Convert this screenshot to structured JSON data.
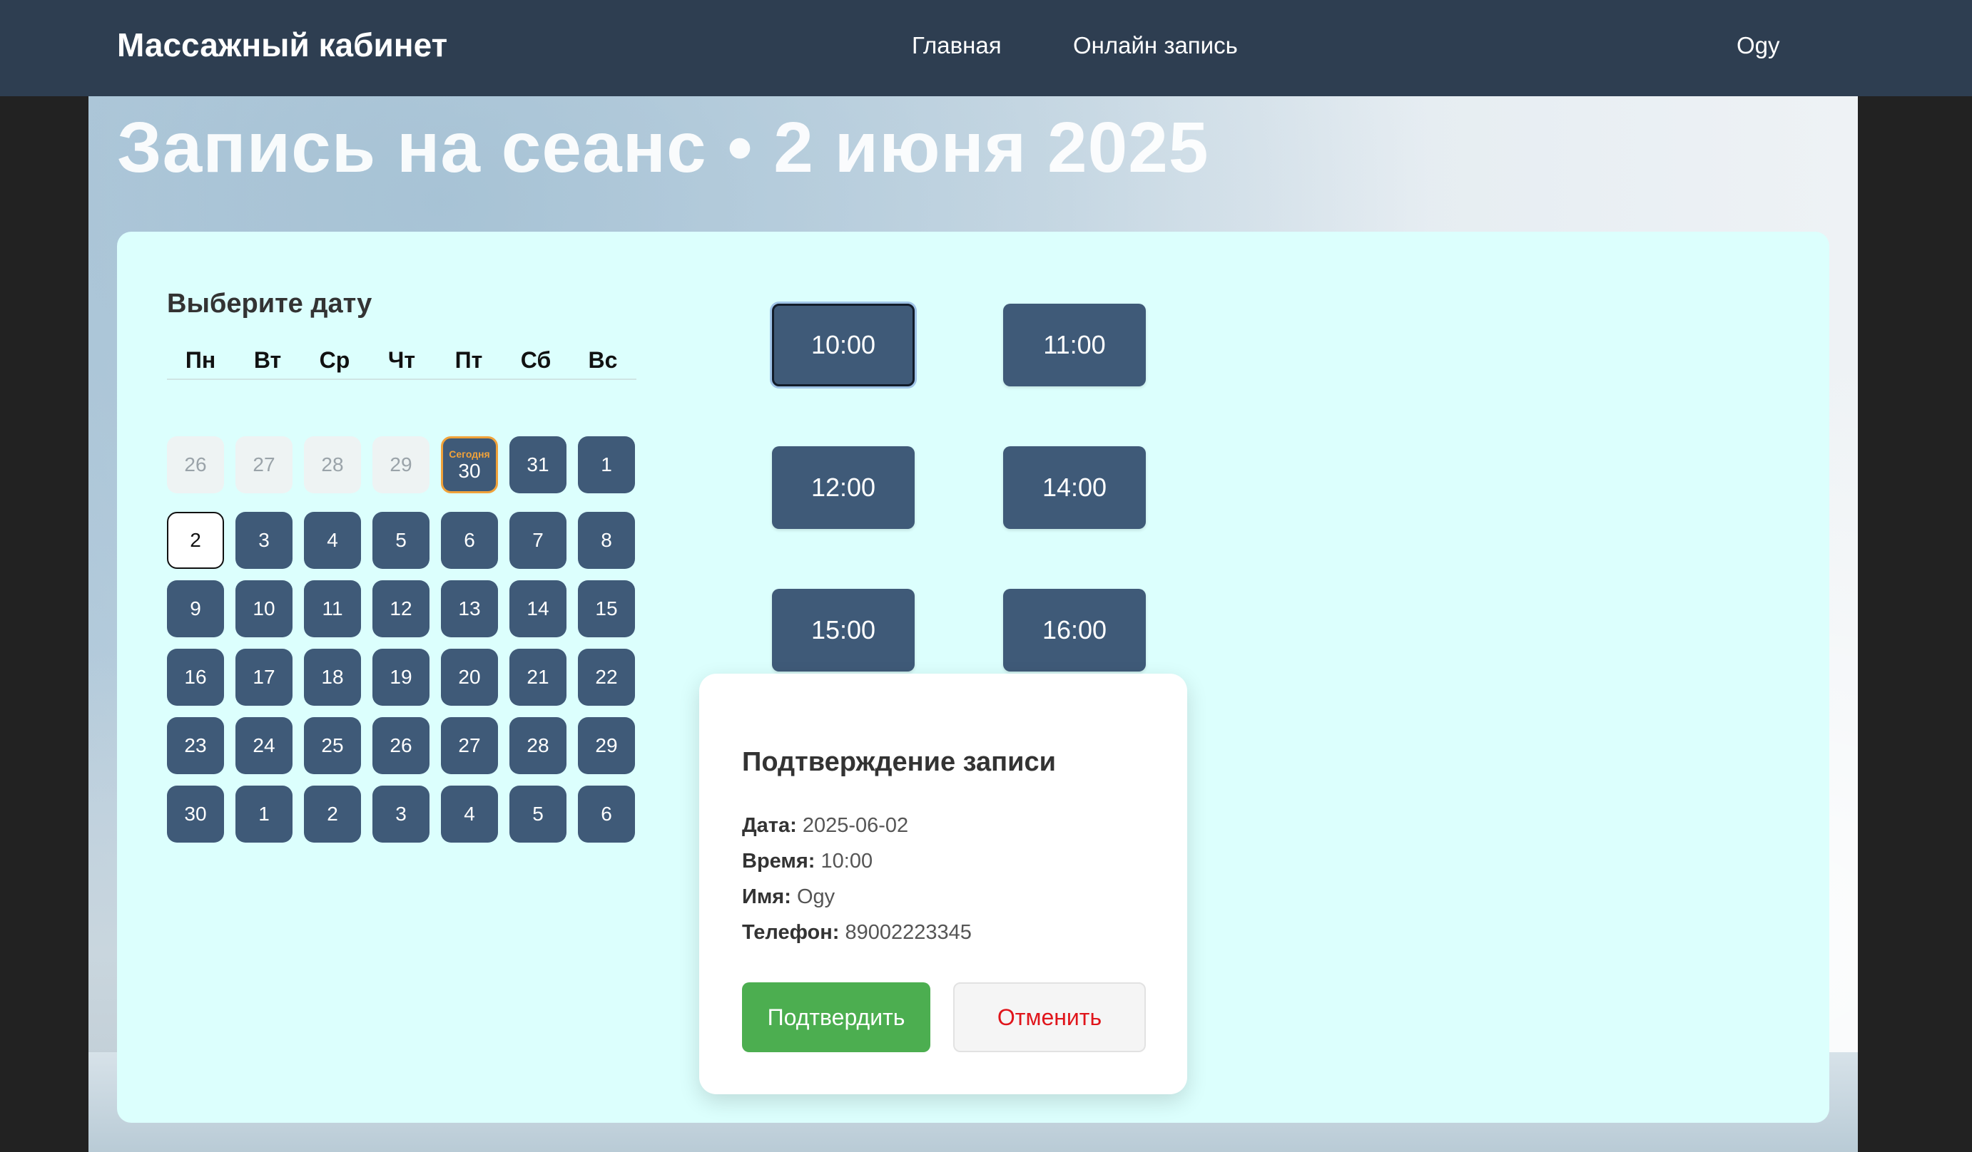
{
  "navbar": {
    "brand": "Массажный кабинет",
    "links": [
      "Главная",
      "Онлайн запись"
    ],
    "user": "Ogy"
  },
  "page": {
    "title": "Запись на сеанс • 2 июня 2025"
  },
  "calendar": {
    "title": "Выберите дату",
    "weekdays": [
      "Пн",
      "Вт",
      "Ср",
      "Чт",
      "Пт",
      "Сб",
      "Вс"
    ],
    "today_label": "Сегодня",
    "days": [
      {
        "n": "26",
        "state": "disabled"
      },
      {
        "n": "27",
        "state": "disabled"
      },
      {
        "n": "28",
        "state": "disabled"
      },
      {
        "n": "29",
        "state": "disabled"
      },
      {
        "n": "30",
        "state": "today"
      },
      {
        "n": "31",
        "state": "normal"
      },
      {
        "n": "1",
        "state": "normal"
      },
      {
        "n": "2",
        "state": "selected"
      },
      {
        "n": "3",
        "state": "normal"
      },
      {
        "n": "4",
        "state": "normal"
      },
      {
        "n": "5",
        "state": "normal"
      },
      {
        "n": "6",
        "state": "normal"
      },
      {
        "n": "7",
        "state": "normal"
      },
      {
        "n": "8",
        "state": "normal"
      },
      {
        "n": "9",
        "state": "normal"
      },
      {
        "n": "10",
        "state": "normal"
      },
      {
        "n": "11",
        "state": "normal"
      },
      {
        "n": "12",
        "state": "normal"
      },
      {
        "n": "13",
        "state": "normal"
      },
      {
        "n": "14",
        "state": "normal"
      },
      {
        "n": "15",
        "state": "normal"
      },
      {
        "n": "16",
        "state": "normal"
      },
      {
        "n": "17",
        "state": "normal"
      },
      {
        "n": "18",
        "state": "normal"
      },
      {
        "n": "19",
        "state": "normal"
      },
      {
        "n": "20",
        "state": "normal"
      },
      {
        "n": "21",
        "state": "normal"
      },
      {
        "n": "22",
        "state": "normal"
      },
      {
        "n": "23",
        "state": "normal"
      },
      {
        "n": "24",
        "state": "normal"
      },
      {
        "n": "25",
        "state": "normal"
      },
      {
        "n": "26",
        "state": "normal"
      },
      {
        "n": "27",
        "state": "normal"
      },
      {
        "n": "28",
        "state": "normal"
      },
      {
        "n": "29",
        "state": "normal"
      },
      {
        "n": "30",
        "state": "normal"
      },
      {
        "n": "1",
        "state": "normal"
      },
      {
        "n": "2",
        "state": "normal"
      },
      {
        "n": "3",
        "state": "normal"
      },
      {
        "n": "4",
        "state": "normal"
      },
      {
        "n": "5",
        "state": "normal"
      },
      {
        "n": "6",
        "state": "normal"
      }
    ]
  },
  "time_slots": {
    "selected": "10:00",
    "items": [
      "10:00",
      "11:00",
      "12:00",
      "14:00",
      "15:00",
      "16:00"
    ]
  },
  "modal": {
    "title": "Подтверждение записи",
    "rows": [
      {
        "label": "Дата:",
        "value": "2025-06-02"
      },
      {
        "label": "Время:",
        "value": "10:00"
      },
      {
        "label": "Имя:",
        "value": "Ogy"
      },
      {
        "label": "Телефон:",
        "value": "89002223345"
      }
    ],
    "confirm_label": "Подтвердить",
    "cancel_label": "Отменить"
  },
  "colors": {
    "navbar": "#2e3e51",
    "card": "#dcfffd",
    "day": "#3f5a78",
    "today_border": "#f0a23a",
    "confirm": "#4cae50",
    "cancel_text": "#e0151b"
  }
}
